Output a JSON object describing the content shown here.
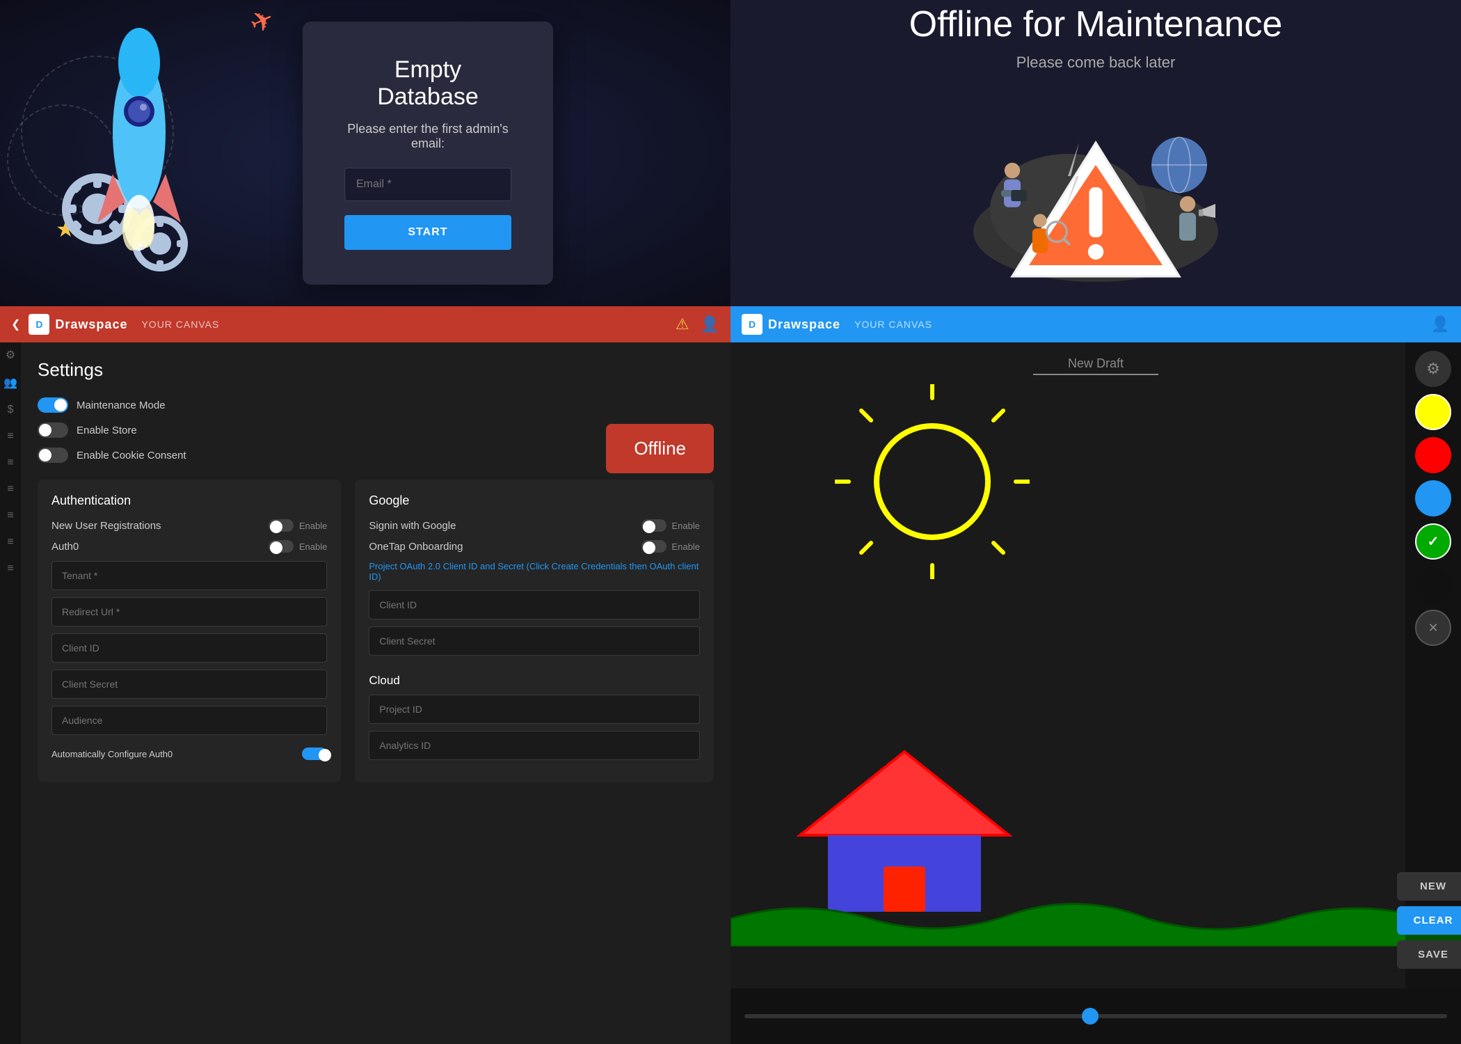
{
  "panels": {
    "empty_db": {
      "title": "Empty Database",
      "subtitle": "Please enter the first admin's email:",
      "email_placeholder": "Email *",
      "start_label": "START"
    },
    "maintenance": {
      "title": "Offline for Maintenance",
      "subtitle": "Please come back later"
    },
    "settings": {
      "title": "Settings",
      "header": {
        "logo_text": "Drawspace",
        "canvas_text": "YOUR CANVAS"
      },
      "toggles": {
        "maintenance_mode": "Maintenance Mode",
        "enable_store": "Enable Store",
        "enable_cookie": "Enable Cookie Consent"
      },
      "offline_btn": "Offline",
      "auth": {
        "title": "Authentication",
        "new_user_reg": "New User Registrations",
        "auth0": "Auth0",
        "enable_label": "Enable",
        "tenant_placeholder": "Tenant *",
        "redirect_placeholder": "Redirect Url *",
        "client_id_placeholder": "Client ID",
        "client_secret_placeholder": "Client Secret",
        "audience_placeholder": "Audience",
        "auto_configure": "Automatically Configure Auth0"
      },
      "google": {
        "title": "Google",
        "signin_label": "Signin with Google",
        "onetap_label": "OneTap Onboarding",
        "enable_label": "Enable",
        "link_text": "Project OAuth 2.0 Client ID and Secret (Click Create Credentials then OAuth client ID)",
        "client_id_placeholder": "Client ID",
        "client_secret_placeholder": "Client Secret",
        "cloud_title": "Cloud",
        "project_id_placeholder": "Project ID",
        "analytics_id_placeholder": "Analytics ID"
      }
    },
    "canvas": {
      "header": {
        "logo_text": "Drawspace",
        "canvas_text": "YOUR CANVAS"
      },
      "draft_title": "New Draft",
      "colors": [
        "#FFFF00",
        "#FF0000",
        "#0000FF",
        "#00AA00",
        "#000000"
      ],
      "buttons": {
        "new": "NEW",
        "clear": "CLEAR",
        "save": "SAVE"
      }
    }
  }
}
